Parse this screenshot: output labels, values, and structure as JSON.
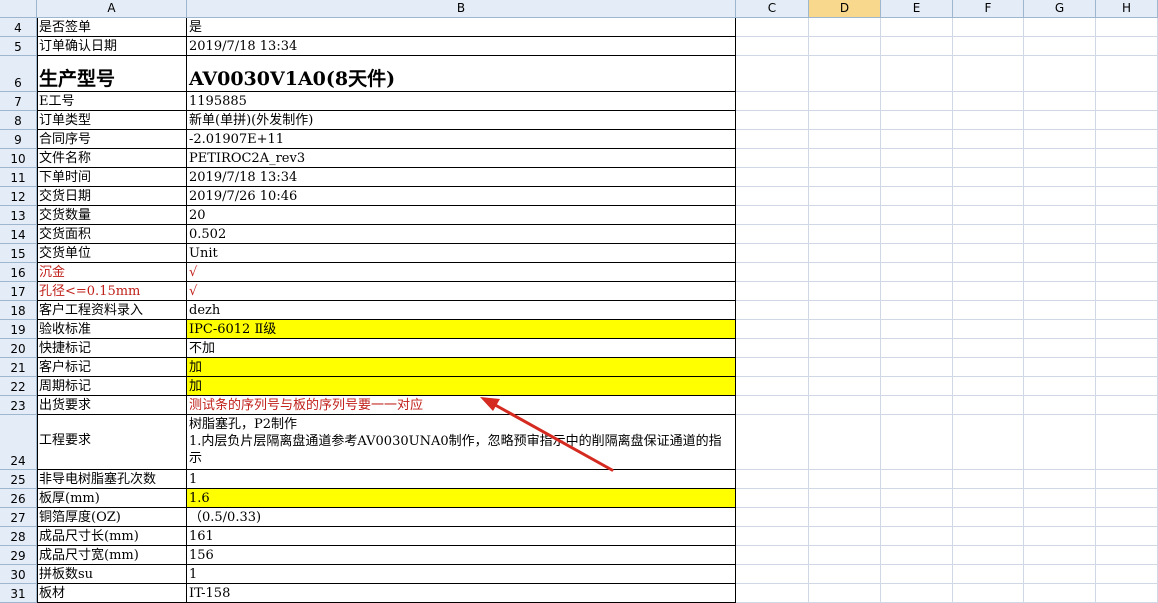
{
  "columns": [
    {
      "id": "corner",
      "label": ""
    },
    {
      "id": "A",
      "label": "A"
    },
    {
      "id": "B",
      "label": "B"
    },
    {
      "id": "C",
      "label": "C"
    },
    {
      "id": "D",
      "label": "D",
      "selected": true
    },
    {
      "id": "E",
      "label": "E"
    },
    {
      "id": "F",
      "label": "F"
    },
    {
      "id": "G",
      "label": "G"
    },
    {
      "id": "H",
      "label": "H"
    }
  ],
  "rows": [
    {
      "num": "4",
      "label": "是否签单",
      "value": "是"
    },
    {
      "num": "5",
      "label": "订单确认日期",
      "value": "2019/7/18 13:34"
    },
    {
      "num": "6",
      "label": "生产型号",
      "value": "AV0030V1A0(8天件)",
      "style": "big"
    },
    {
      "num": "7",
      "label": "E工号",
      "value": "1195885"
    },
    {
      "num": "8",
      "label": "订单类型",
      "value": "新单(单拼)(外发制作)"
    },
    {
      "num": "9",
      "label": "合同序号",
      "value": "-2.01907E+11"
    },
    {
      "num": "10",
      "label": "文件名称",
      "value": "PETIROC2A_rev3"
    },
    {
      "num": "11",
      "label": "下单时间",
      "value": "2019/7/18 13:34"
    },
    {
      "num": "12",
      "label": "交货日期",
      "value": "2019/7/26 10:46"
    },
    {
      "num": "13",
      "label": "交货数量",
      "value": "20"
    },
    {
      "num": "14",
      "label": "交货面积",
      "value": "0.502"
    },
    {
      "num": "15",
      "label": "交货单位",
      "value": "Unit"
    },
    {
      "num": "16",
      "label": "沉金",
      "value": "√",
      "label_color": "red",
      "value_color": "red"
    },
    {
      "num": "17",
      "label": "孔径<=0.15mm",
      "value": "√",
      "label_color": "red",
      "value_color": "red"
    },
    {
      "num": "18",
      "label": "客户工程资料录入",
      "value": "dezh"
    },
    {
      "num": "19",
      "label": "验收标准",
      "value": "IPC-6012 Ⅱ级",
      "highlight": "#ffff00"
    },
    {
      "num": "20",
      "label": "快捷标记",
      "value": "不加"
    },
    {
      "num": "21",
      "label": "客户标记",
      "value": "加",
      "highlight": "#ffff00"
    },
    {
      "num": "22",
      "label": "周期标记",
      "value": "加",
      "highlight": "#ffff00"
    },
    {
      "num": "23",
      "label": "出货要求",
      "value": "测试条的序列号与板的序列号要一一对应",
      "value_color": "red"
    },
    {
      "num": "24",
      "label": "工程要求",
      "value": "树脂塞孔，P2制作\n1.内层负片层隔离盘通道参考AV0030UNA0制作，忽略预审指示中的削隔离盘保证通道的指示",
      "style": "multi"
    },
    {
      "num": "25",
      "label": "非导电树脂塞孔次数",
      "value": "1"
    },
    {
      "num": "26",
      "label": "板厚(mm)",
      "value": "1.6",
      "highlight": "#ffff00"
    },
    {
      "num": "27",
      "label": "铜箔厚度(OZ)",
      "value": "（0.5/0.33)"
    },
    {
      "num": "28",
      "label": "成品尺寸长(mm)",
      "value": "161"
    },
    {
      "num": "29",
      "label": "成品尺寸宽(mm)",
      "value": "156"
    },
    {
      "num": "30",
      "label": "拼板数su",
      "value": "1"
    },
    {
      "num": "31",
      "label": "板材",
      "value": "IT-158"
    }
  ],
  "annotation": {
    "type": "arrow",
    "color": "#d42a20",
    "target": "出货要求"
  },
  "colors": {
    "header_bg": "#e4ecf7",
    "selected_header": "#f8d88c",
    "highlight": "#ffff00",
    "red_text": "#c0201a"
  }
}
